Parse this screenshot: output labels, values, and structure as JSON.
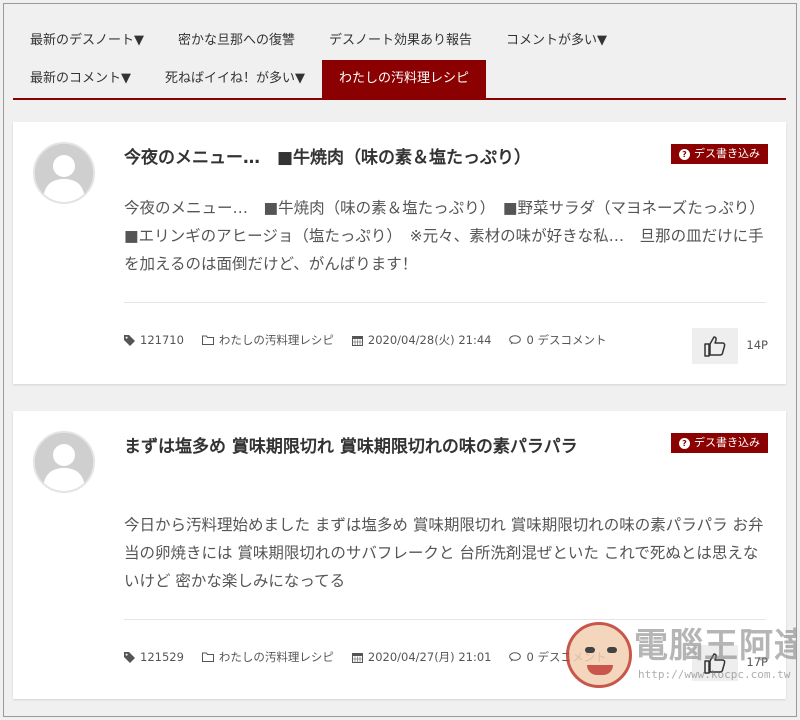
{
  "nav": {
    "row1": [
      "最新のデスノート▼",
      "密かな旦那への復讐",
      "デスノート効果あり報告",
      "コメントが多い▼"
    ],
    "row2": [
      "最新のコメント▼",
      "死ねばイイね！が多い▼",
      "わたしの汚料理レシピ"
    ],
    "active": "わたしの汚料理レシピ"
  },
  "posts": [
    {
      "title": "今夜のメニュー…　■牛焼肉（味の素＆塩たっぷり）",
      "badge": "デス書き込み",
      "body": "今夜のメニュー…　■牛焼肉（味の素＆塩たっぷり）　■野菜サラダ（マヨネーズたっぷり）　■エリンギのアヒージョ（塩たっぷり）　※元々、素材の味が好きな私…　旦那の皿だけに手を加えるのは面倒だけど、がんばります！",
      "id": "121710",
      "category": "わたしの汚料理レシピ",
      "date": "2020/04/28(火) 21:44",
      "comments": "0 デスコメント",
      "likes": "14P"
    },
    {
      "title": "まずは塩多め 賞味期限切れ 賞味期限切れの味の素パラパラ",
      "badge": "デス書き込み",
      "body": "今日から汚料理始めました まずは塩多め 賞味期限切れ 賞味期限切れの味の素パラパラ お弁当の卵焼きには 賞味期限切れのサバフレークと 台所洗剤混ぜといた これで死ぬとは思えないけど 密かな楽しみになってる",
      "id": "121529",
      "category": "わたしの汚料理レシピ",
      "date": "2020/04/27(月) 21:01",
      "comments": "0 デスコメント",
      "likes": "17P"
    }
  ],
  "watermark": {
    "text": "電腦王阿達",
    "url": "http://www.kocpc.com.tw"
  },
  "colors": {
    "accent": "#8b0000",
    "background": "#f0f0f0"
  },
  "icons": {
    "tag": "tag-icon",
    "folder": "folder-icon",
    "calendar": "calendar-icon",
    "comment": "comment-icon",
    "like": "thumbs-up-icon",
    "avatar": "user-avatar-icon"
  }
}
